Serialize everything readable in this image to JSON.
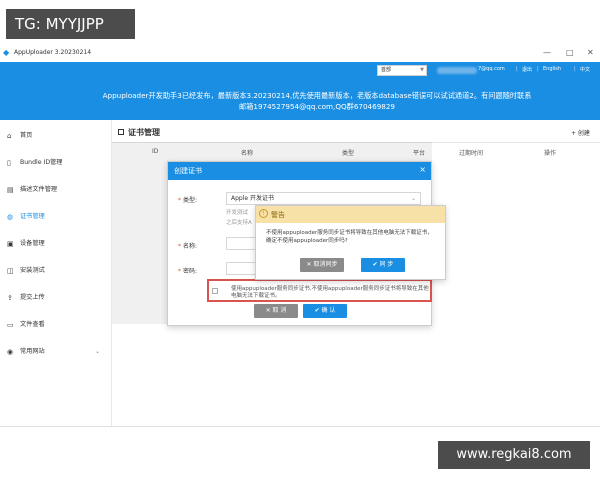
{
  "watermarks": {
    "tag": "TG: MYYJJPP",
    "url": "www.regkai8.com"
  },
  "window": {
    "title": "AppUploader 3.20230214",
    "minimize_glyph": "—",
    "maximize_glyph": "□",
    "close_glyph": "✕"
  },
  "header": {
    "language_value": "首部",
    "account_suffix": "7@qq.com",
    "separator": "|",
    "exit_link": "退出",
    "english_link": "English",
    "chinese_link": "中文",
    "notice_line1": "Appuploader开发助手3已经发布，最新版本3.20230214,优先使用最新版本，老版本database错误可以试试通道2。有问题随时联系",
    "notice_line2": "邮箱1974527954@qq.com,QQ群670469829"
  },
  "sidebar": {
    "items": [
      {
        "icon": "home-icon",
        "glyph": "⌂",
        "label": "首页"
      },
      {
        "icon": "phone-icon",
        "glyph": "▯",
        "label": "Bundle ID管理"
      },
      {
        "icon": "document-icon",
        "glyph": "▤",
        "label": "描述文件管理"
      },
      {
        "icon": "certificate-icon",
        "glyph": "◍",
        "label": "证书管理"
      },
      {
        "icon": "device-icon",
        "glyph": "▣",
        "label": "设备管理"
      },
      {
        "icon": "install-icon",
        "glyph": "◫",
        "label": "安装测试"
      },
      {
        "icon": "upload-icon",
        "glyph": "⇪",
        "label": "提交上传"
      },
      {
        "icon": "folder-icon",
        "glyph": "▭",
        "label": "文件查看"
      },
      {
        "icon": "location-icon",
        "glyph": "◉",
        "label": "常用网站"
      }
    ],
    "active_index": 3,
    "expand_glyph": "⌄"
  },
  "main": {
    "title": "证书管理",
    "create_button": "+ 创建",
    "columns": [
      "ID",
      "名称",
      "类型",
      "平台",
      "过期时间",
      "操作"
    ]
  },
  "create_dialog": {
    "title": "创建证书",
    "close_glyph": "×",
    "type_label": "类型:",
    "type_value": "Apple 开发证书",
    "type_hint_1": "开发测试",
    "type_hint_2": "之后支持A",
    "name_label": "名称:",
    "password_label": "密码:",
    "checkbox_text": "使用appuploader服务同步证书,不使用appuploader服务同步证书将导致在其他电脑无法下载证书。",
    "cancel_button": "✕ 取 消",
    "confirm_button": "✔ 确 认"
  },
  "alert_dialog": {
    "title": "警告",
    "icon_glyph": "!",
    "message": "不使用appuploader服务同步证书将导致在其他电脑无法下载证书，确定不使用appuploader同步吗?",
    "cancel_button": "✕ 取消同步",
    "confirm_button": "✔ 同 步"
  },
  "colors": {
    "primary": "#1a8ee3",
    "warning_header": "#f7e1a6",
    "highlight": "#d9534f",
    "button_gray": "#8a8a8a"
  }
}
